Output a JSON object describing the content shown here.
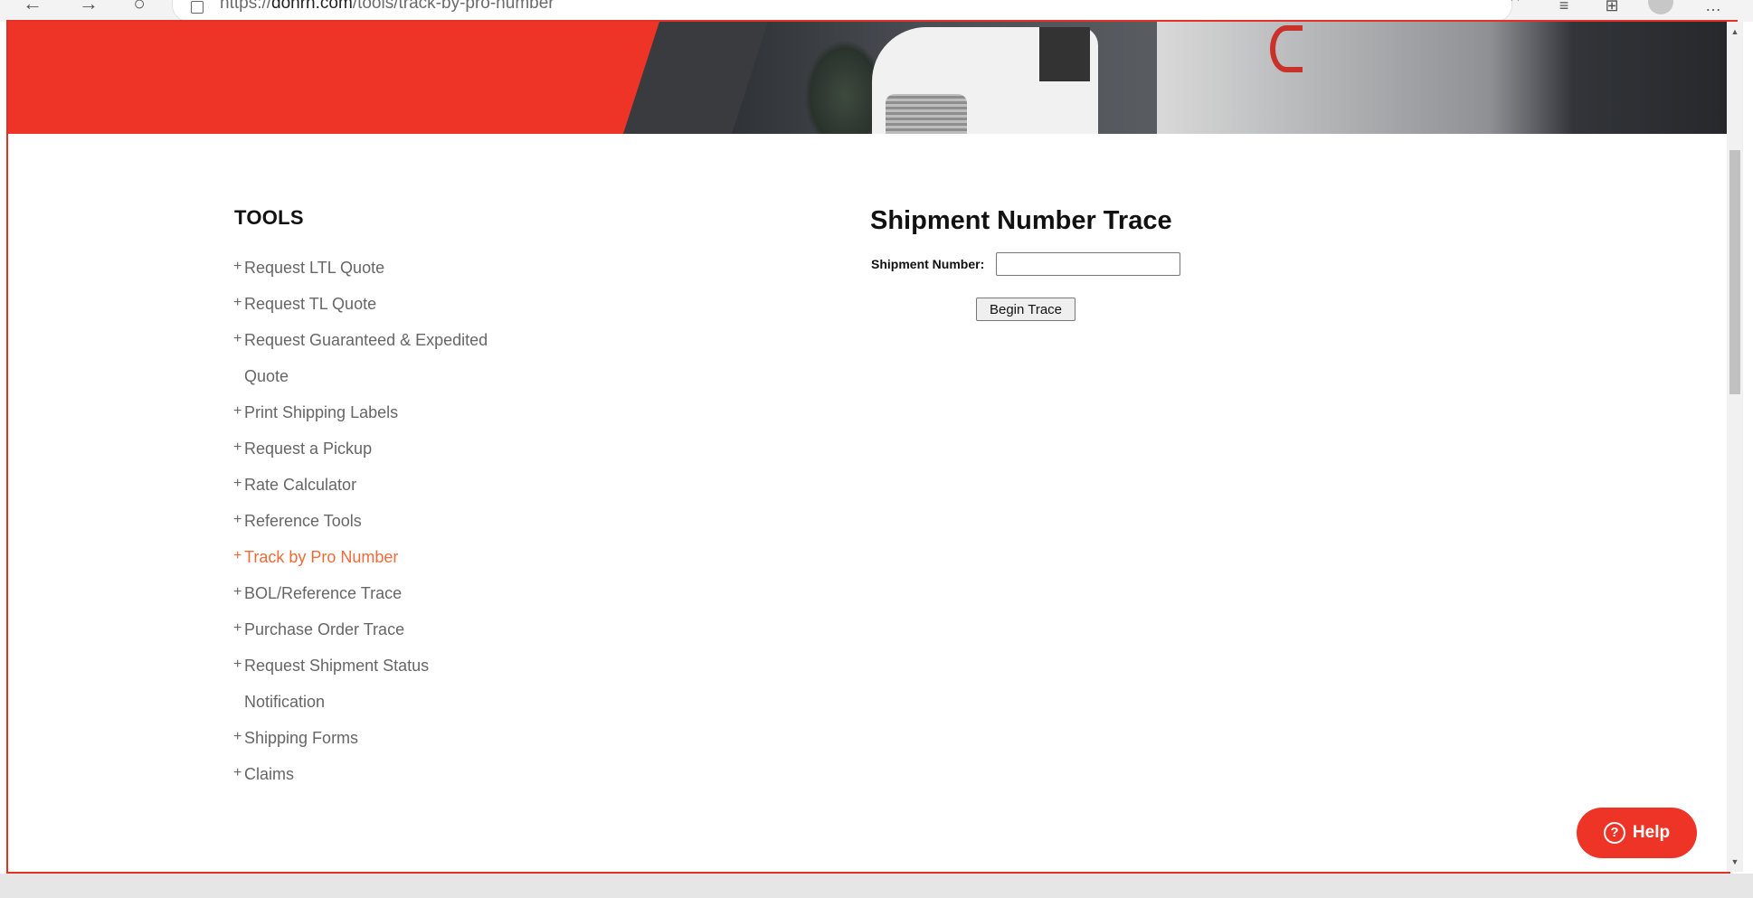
{
  "browser": {
    "url_prefix": "https://",
    "url_host": "dohrn.com",
    "url_path": "/tools/track-by-pro-number"
  },
  "sidebar": {
    "title": "TOOLS",
    "plus_glyph": "+",
    "items": [
      {
        "label": "Request LTL Quote"
      },
      {
        "label": "Request TL Quote"
      },
      {
        "label": "Request Guaranteed & Expedited"
      },
      {
        "label": "Quote"
      },
      {
        "label": "Print Shipping Labels"
      },
      {
        "label": "Request a Pickup"
      },
      {
        "label": "Rate Calculator"
      },
      {
        "label": "Reference Tools"
      },
      {
        "label": "Track by Pro Number"
      },
      {
        "label": "BOL/Reference Trace"
      },
      {
        "label": "Purchase Order Trace"
      },
      {
        "label": "Request Shipment Status"
      },
      {
        "label": "Notification"
      },
      {
        "label": "Shipping Forms"
      },
      {
        "label": "Claims"
      }
    ],
    "active_label": "Track by Pro Number"
  },
  "trace": {
    "title": "Shipment Number Trace",
    "field_label": "Shipment Number:",
    "field_value": "",
    "button_label": "Begin Trace"
  },
  "help": {
    "label": "Help",
    "icon_glyph": "?"
  },
  "colors": {
    "brand_red": "#ee3427",
    "active_link": "#ee6b3b",
    "link_gray": "#666666"
  }
}
